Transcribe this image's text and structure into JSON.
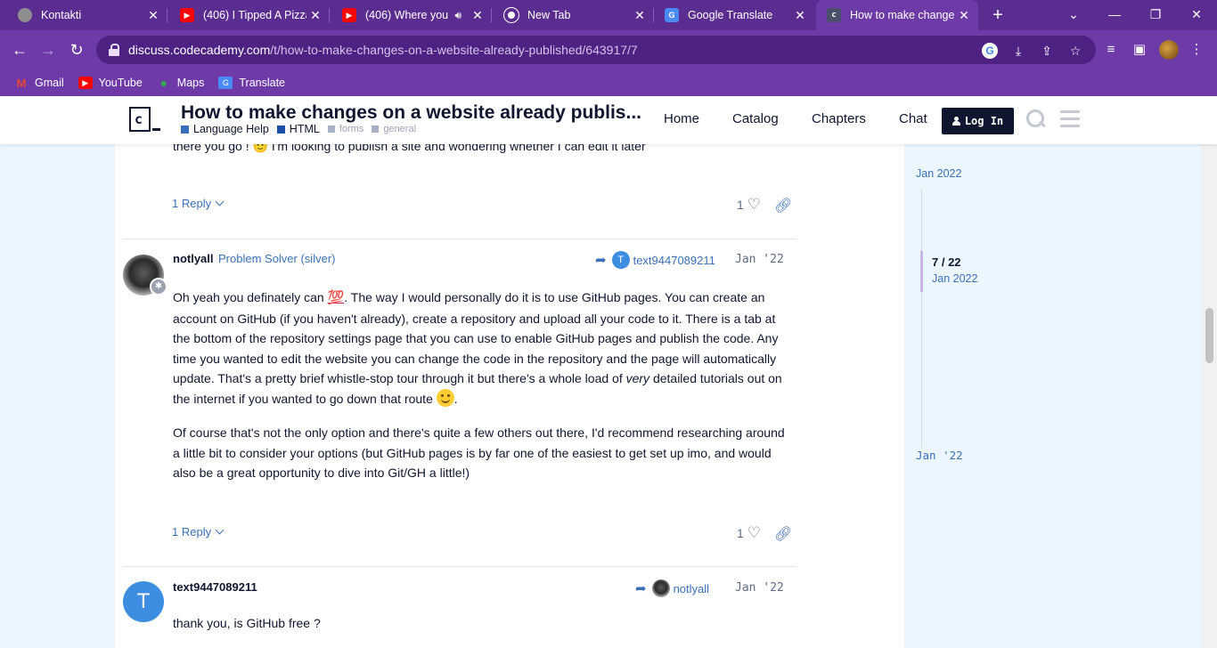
{
  "browser": {
    "tabs": [
      {
        "title": "Kontakti",
        "favicon": "globe-icon"
      },
      {
        "title": "(406) I Tipped A Pizza",
        "favicon": "youtube-icon"
      },
      {
        "title": "(406) Where you",
        "favicon": "youtube-icon"
      },
      {
        "title": "New Tab",
        "favicon": "chrome-icon"
      },
      {
        "title": "Google Translate",
        "favicon": "translate-icon"
      },
      {
        "title": "How to make change",
        "favicon": "codecademy-icon",
        "active": true
      }
    ],
    "url_host": "discuss.codecademy.com",
    "url_path": "/t/how-to-make-changes-on-a-website-already-published/643917/7",
    "bookmarks": [
      {
        "label": "Gmail",
        "icon": "gmail-icon"
      },
      {
        "label": "YouTube",
        "icon": "youtube-icon"
      },
      {
        "label": "Maps",
        "icon": "maps-icon"
      },
      {
        "label": "Translate",
        "icon": "translate-icon"
      }
    ]
  },
  "header": {
    "logo_text": "c",
    "topic_title": "How to make changes on a website already publis...",
    "category": "Language Help",
    "subcategory": "HTML",
    "tags": [
      "forms",
      "general"
    ],
    "nav": [
      "Home",
      "Catalog",
      "Chapters",
      "Chat"
    ],
    "login_label": "Log In",
    "colors": {
      "language_help": "#3a70b9",
      "html": "#1e4fa8",
      "tag": "#a8b0c8"
    }
  },
  "posts": [
    {
      "text_partial": "there you go ! 🙂 I'm looking to publish a site and wondering whether I can edit it later",
      "replies": "1 Reply",
      "likes": "1"
    },
    {
      "username": "notlyall",
      "user_title": "Problem Solver (silver)",
      "reply_to": "text9447089211",
      "reply_to_initial": "T",
      "date": "Jan '22",
      "para1_a": "Oh yeah you definately can ",
      "para1_emoji": "💯",
      "para1_b": ". The way I would personally do it is to use GitHub pages. You can create an account on GitHub (if you haven't already), create a repository and upload all your code to it. There is a tab at the bottom of the repository settings page that you can use to enable GitHub pages and publish the code. Any time you wanted to edit the website you can change the code in the repository and the page will automatically update. That's a pretty brief whistle-stop tour through it but there's a whole load of ",
      "para1_em": "very",
      "para1_c": " detailed tutorials out on the internet if you wanted to go down that route ",
      "para1_d": ".",
      "para2": "Of course that's not the only option and there's quite a few others out there, I'd recommend researching around a little bit to consider your options (but GitHub pages is by far one of the easiest to get set up imo, and would also be a great opportunity to dive into Git/GH a little!)",
      "replies": "1 Reply",
      "likes": "1"
    },
    {
      "username": "text9447089211",
      "avatar_initial": "T",
      "reply_to": "notlyall",
      "date": "Jan '22",
      "text": "thank you, is GitHub free ?"
    }
  ],
  "timeline": {
    "top_date": "Jan 2022",
    "position": "7 / 22",
    "position_date": "Jan 2022",
    "bottom_date": "Jan '22"
  }
}
